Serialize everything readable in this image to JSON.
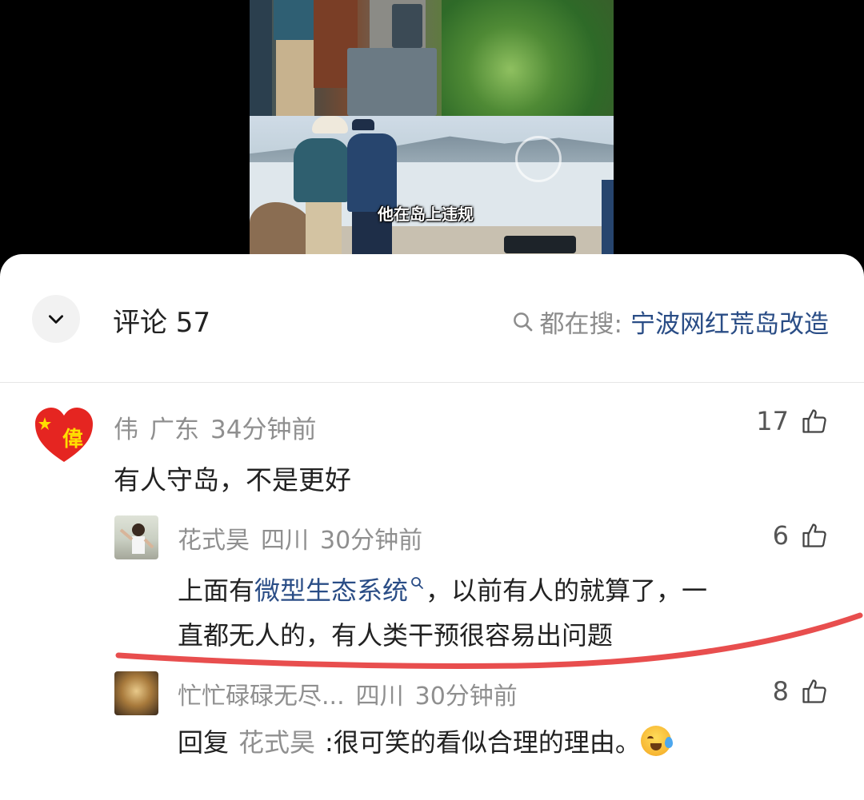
{
  "video": {
    "subtitle": "他在岛上违规"
  },
  "header": {
    "title": "评论 57",
    "search_label": "都在搜:",
    "search_keyword": "宁波网红荒岛改造"
  },
  "comments": [
    {
      "user": "伟",
      "location": "广东",
      "time": "34分钟前",
      "text": "有人守岛，不是更好",
      "likes": "17",
      "avatar_char": "偉",
      "replies": [
        {
          "user": "花式昊",
          "location": "四川",
          "time": "30分钟前",
          "text_before": "上面有",
          "link_text": "微型生态系统",
          "text_after_line1": "，以前有人的就算了，一",
          "text_line2": "直都无人的，有人类干预很容易出问题",
          "likes": "6"
        },
        {
          "user": "忙忙碌碌无尽...",
          "location": "四川",
          "time": "30分钟前",
          "reply_prefix": "回复",
          "reply_to": "花式昊",
          "text": ":很可笑的看似合理的理由。",
          "likes": "8"
        }
      ]
    }
  ],
  "colors": {
    "accent_link": "#2a4d86",
    "annotation": "#e63b3b"
  }
}
